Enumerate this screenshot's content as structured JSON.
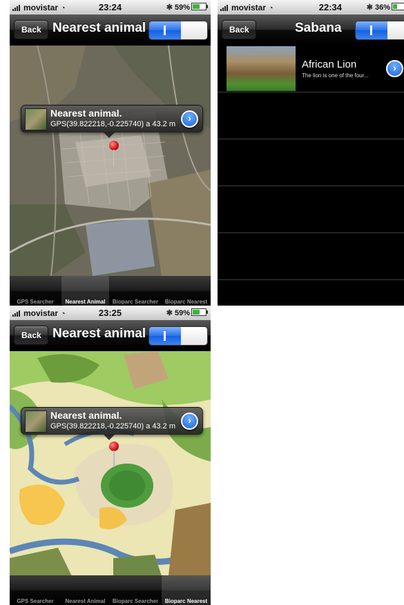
{
  "screens": [
    {
      "status": {
        "carrier": "movistar",
        "time": "23:24",
        "battery": "59%"
      },
      "nav": {
        "back": "Back",
        "title": "Nearest animal"
      },
      "callout": {
        "title": "Nearest animal.",
        "subtitle": "GPS(39.822218,-0.225740) a 43.2 m"
      },
      "tabs": [
        "GPS Searcher",
        "Nearest Animal",
        "Bioparc Searcher",
        "Bioparc Nearest"
      ],
      "selected_tab": 1
    },
    {
      "status": {
        "carrier": "movistar",
        "time": "22:34",
        "battery": "36%"
      },
      "nav": {
        "back": "Back",
        "title": "Sabana"
      },
      "list": [
        {
          "title": "African Lion",
          "subtitle": "The lion is one of the four..."
        }
      ]
    },
    {
      "status": {
        "carrier": "movistar",
        "time": "23:25",
        "battery": "59%"
      },
      "nav": {
        "back": "Back",
        "title": "Nearest animal"
      },
      "callout": {
        "title": "Nearest animal.",
        "subtitle": "GPS(39.822218,-0.225740) a 43.2 m"
      },
      "tabs": [
        "GPS Searcher",
        "Nearest Animal",
        "Bioparc Searcher",
        "Bioparc Nearest"
      ],
      "selected_tab": 3
    }
  ],
  "icons": {
    "signal": "signal-bars-icon",
    "wifi": "wifi-icon",
    "bluetooth": "bluetooth-icon",
    "battery": "battery-icon",
    "disclosure": "disclosure-chevron-icon",
    "pin": "map-pin-icon"
  },
  "colors": {
    "toggle_on": "#2a73ea",
    "pin": "#d10f0f",
    "battery_fill": "#3bb53b"
  }
}
